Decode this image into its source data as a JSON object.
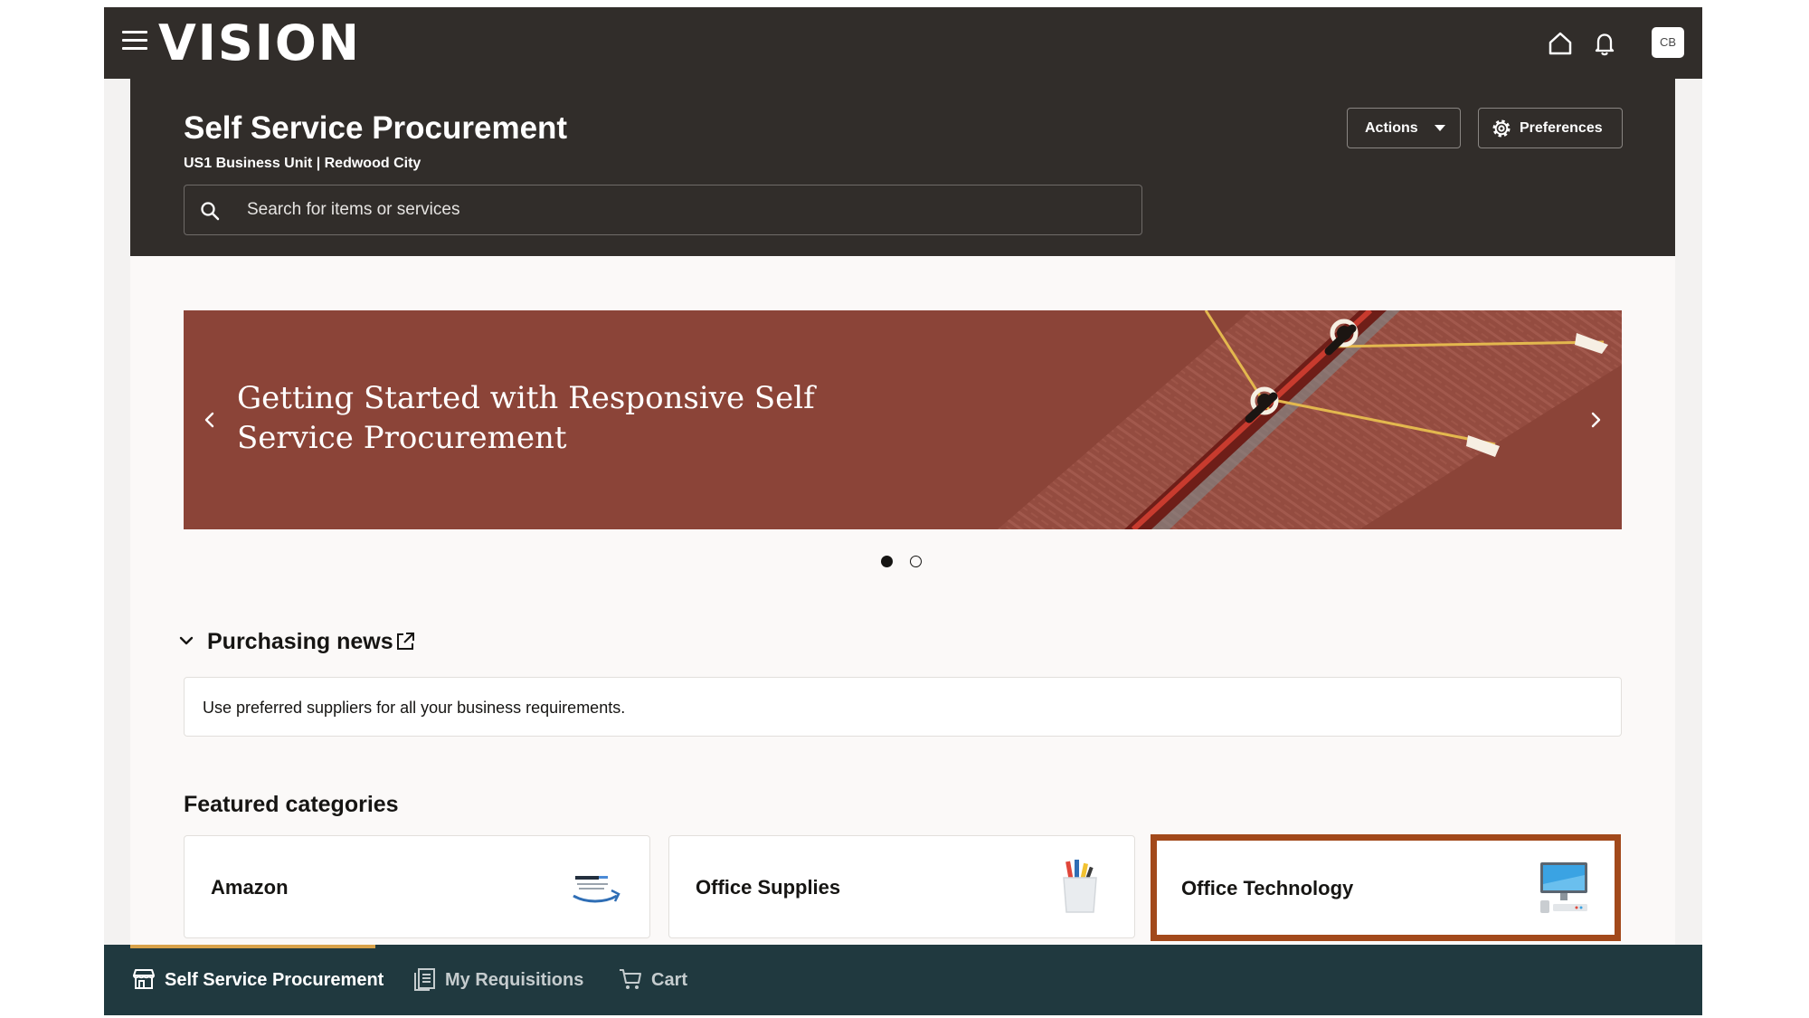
{
  "app": {
    "logo": "VISION",
    "avatar_initials": "CB"
  },
  "header": {
    "title": "Self Service Procurement",
    "subtitle": "US1 Business Unit | Redwood City",
    "search_placeholder": "Search for items or services",
    "actions_label": "Actions",
    "preferences_label": "Preferences"
  },
  "banner": {
    "title": "Getting Started with Responsive Self Service Procurement",
    "slide_count": 2,
    "active_slide": 1
  },
  "news": {
    "title": "Purchasing news",
    "message": "Use preferred suppliers for all your business requirements."
  },
  "featured": {
    "title": "Featured categories",
    "categories": [
      {
        "label": "Amazon",
        "icon": "amazon-business-icon"
      },
      {
        "label": "Office Supplies",
        "icon": "office-supplies-icon"
      },
      {
        "label": "Office Technology",
        "icon": "computer-monitor-icon",
        "highlighted": true
      }
    ]
  },
  "bottom_nav": {
    "items": [
      {
        "label": "Self Service Procurement",
        "icon": "storefront-icon",
        "active": true
      },
      {
        "label": "My Requisitions",
        "icon": "requisitions-icon",
        "active": false
      },
      {
        "label": "Cart",
        "icon": "cart-icon",
        "active": false
      }
    ]
  },
  "colors": {
    "header_bg": "#312d2a",
    "banner_bg": "#8b4438",
    "bottom_nav_bg": "#20393f",
    "highlight_border": "#a2491b",
    "active_tab_indicator": "#d8a24a"
  }
}
